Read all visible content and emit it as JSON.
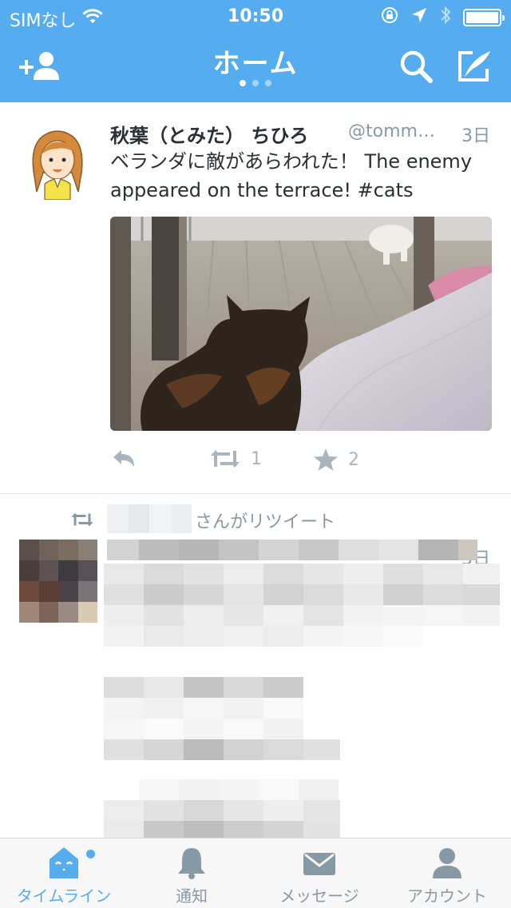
{
  "status_bar": {
    "carrier": "SIMなし",
    "time": "10:50"
  },
  "nav": {
    "title": "ホーム",
    "page_dots": 3,
    "active_dot": 0
  },
  "tweet": {
    "name": "秋葉（とみた） ちひろ",
    "handle": "@tomm…",
    "time": "3日",
    "text": "ベランダに敵があらわれた！ The enemy appeared on the terrace! #cats",
    "retweet_count": "1",
    "favorite_count": "2"
  },
  "retweet": {
    "label": "さんがリツイート",
    "time": "3日"
  },
  "tabs": [
    {
      "label": "タイムライン",
      "icon": "home-icon",
      "active": true
    },
    {
      "label": "通知",
      "icon": "bell-icon",
      "active": false
    },
    {
      "label": "メッセージ",
      "icon": "envelope-icon",
      "active": false
    },
    {
      "label": "アカウント",
      "icon": "person-icon",
      "active": false
    }
  ],
  "colors": {
    "brand": "#55acee",
    "muted": "#8899a6",
    "icon_muted": "#a8b5bf",
    "text": "#292f33"
  }
}
